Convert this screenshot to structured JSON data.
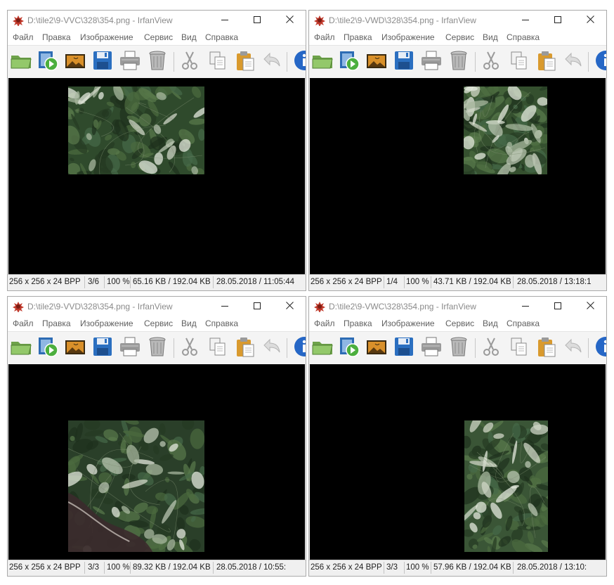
{
  "windows": [
    {
      "title": "D:\\tile2\\9-VVC\\328\\354.png - IrfanView",
      "menu": [
        "Файл",
        "Правка",
        "Изображение",
        "Сервис",
        "Вид",
        "Справка"
      ],
      "status": {
        "dims": "256 x 256 x 24 BPP",
        "index": "3/6",
        "zoom": "100 %",
        "size": "65.16 KB / 192.04 KB",
        "date": "28.05.2018 / 11:05:44"
      }
    },
    {
      "title": "D:\\tile2\\9-VWD\\328\\354.png - IrfanView",
      "menu": [
        "Файл",
        "Правка",
        "Изображение",
        "Сервис",
        "Вид",
        "Справка"
      ],
      "status": {
        "dims": "256 x 256 x 24 BPP",
        "index": "1/4",
        "zoom": "100 %",
        "size": "43.71 KB / 192.04 KB",
        "date": "28.05.2018 / 13:18:1"
      }
    },
    {
      "title": "D:\\tile2\\9-VVD\\328\\354.png - IrfanView",
      "menu": [
        "Файл",
        "Правка",
        "Изображение",
        "Сервис",
        "Вид",
        "Справка"
      ],
      "status": {
        "dims": "256 x 256 x 24 BPP",
        "index": "3/3",
        "zoom": "100 %",
        "size": "89.32 KB / 192.04 KB",
        "date": "28.05.2018 / 10:55:"
      }
    },
    {
      "title": "D:\\tile2\\9-VWC\\328\\354.png - IrfanView",
      "menu": [
        "Файл",
        "Правка",
        "Изображение",
        "Сервис",
        "Вид",
        "Справка"
      ],
      "status": {
        "dims": "256 x 256 x 24 BPP",
        "index": "3/3",
        "zoom": "100 %",
        "size": "57.96 KB / 192.04 KB",
        "date": "28.05.2018 / 13:10:"
      }
    }
  ],
  "toolbar_icons": [
    "open-folder-icon",
    "slideshow-icon",
    "thumbnails-icon",
    "save-icon",
    "print-icon",
    "delete-icon",
    "cut-icon",
    "copy-icon",
    "paste-icon",
    "undo-icon",
    "info-icon"
  ],
  "colors": {
    "viewer_bg": "#000000",
    "chrome_bg": "#f0f0f0",
    "forest": "#2f4a2c",
    "clearing": "#cfd6c6"
  }
}
